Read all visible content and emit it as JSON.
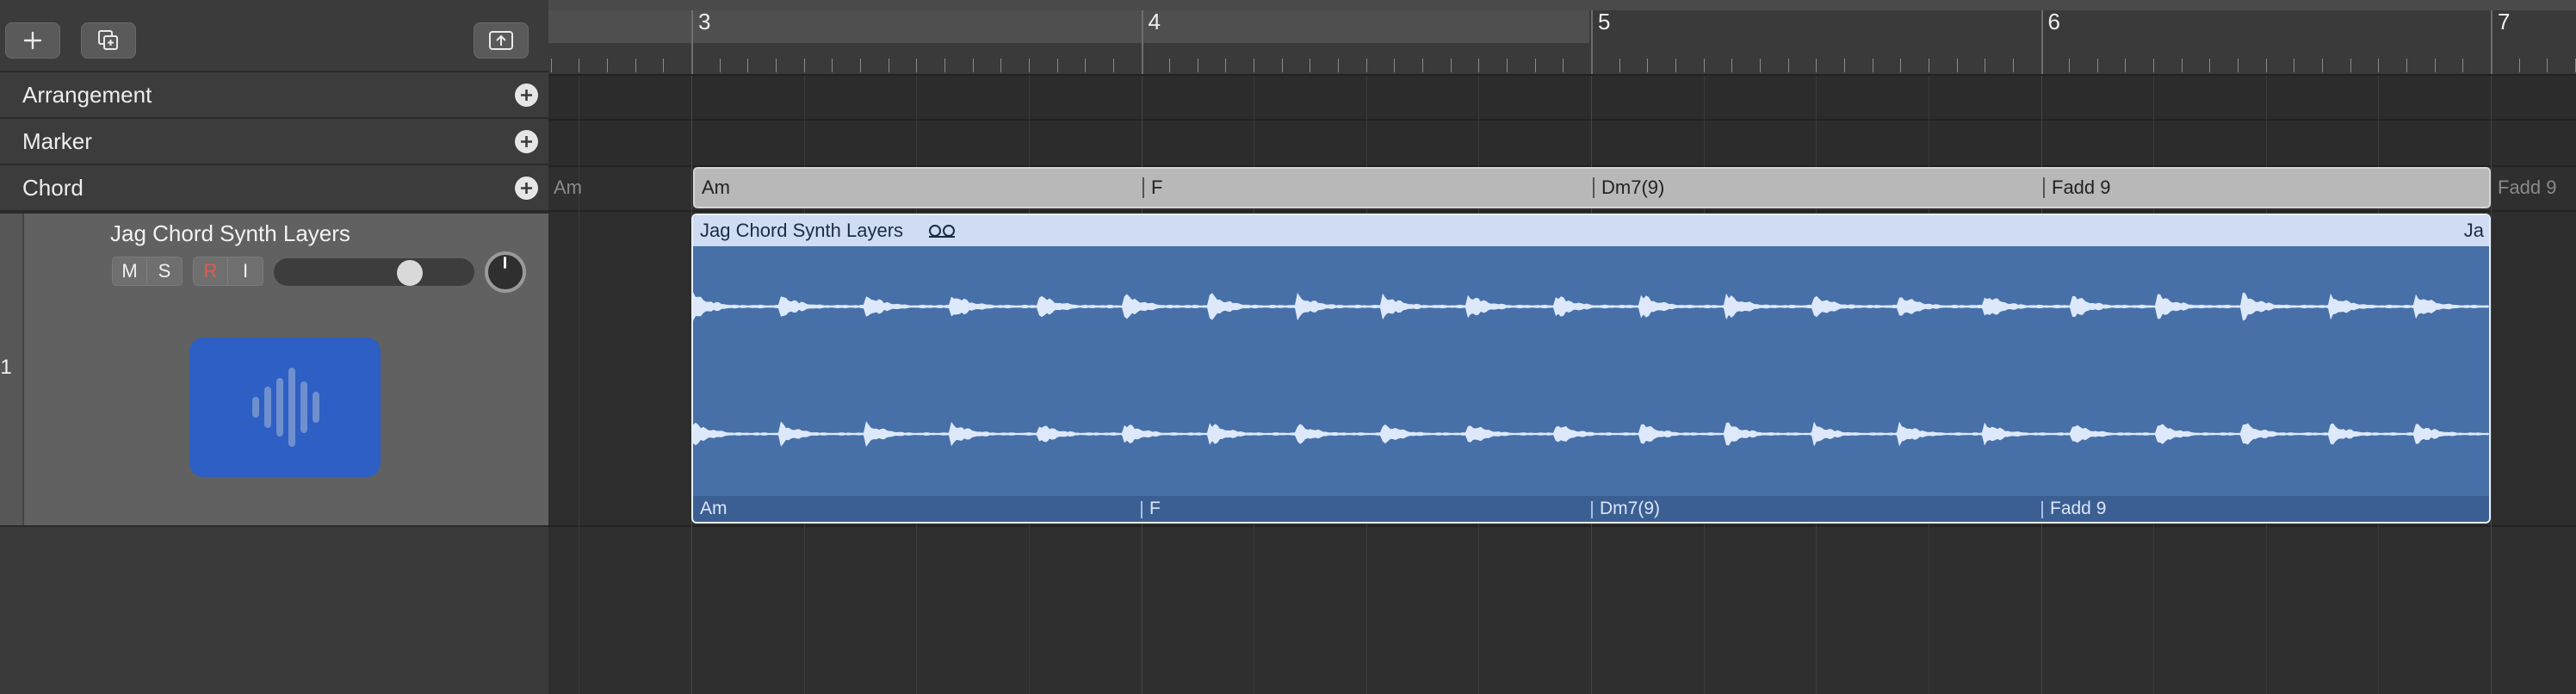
{
  "toolbar": {
    "add_track": "plus-icon",
    "duplicate_track": "duplicate-icon",
    "catch_playhead": "upload-box-icon"
  },
  "global_tracks": [
    {
      "label": "Arrangement"
    },
    {
      "label": "Marker"
    },
    {
      "label": "Chord"
    }
  ],
  "track": {
    "number": "1",
    "name": "Jag Chord Synth Layers",
    "mute": "M",
    "solo": "S",
    "record": "R",
    "input": "I",
    "volume_level": 0.72,
    "icon": "audio-waveform-icon"
  },
  "ruler": {
    "bars": [
      "3",
      "4",
      "5",
      "6",
      "7"
    ]
  },
  "chord_track": {
    "ghost_before": "Am",
    "ghost_after": "Fadd 9",
    "chords": [
      "Am",
      "F",
      "Dm7(9)",
      "Fadd 9"
    ]
  },
  "region": {
    "title": "Jag Chord Synth Layers",
    "title_right": "Ja",
    "loop_icon": "loop-icon",
    "footer_chords": [
      "Am",
      "F",
      "Dm7(9)",
      "Fadd 9"
    ]
  },
  "colors": {
    "region_body": "#4770a8",
    "region_header": "#cfdcf4",
    "waveform": "#dde8fb",
    "track_icon": "#2e5fc4",
    "record": "#e25a50"
  }
}
